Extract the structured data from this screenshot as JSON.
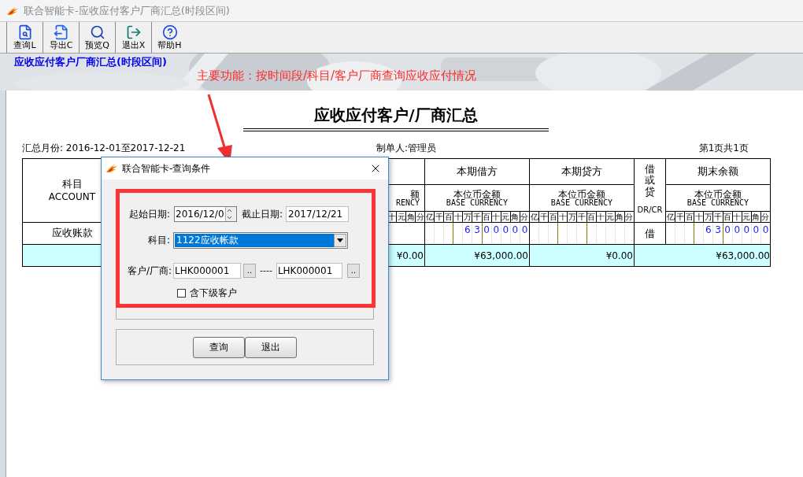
{
  "window": {
    "title": "联合智能卡-应收应付客户厂商汇总(时段区间)"
  },
  "toolbar": [
    {
      "label": "查询L",
      "kind": "query"
    },
    {
      "label": "导出C",
      "kind": "export"
    },
    {
      "label": "预览Q",
      "kind": "preview"
    },
    {
      "label": "退出X",
      "kind": "exit"
    },
    {
      "label": "帮助H",
      "kind": "help"
    }
  ],
  "banner": {
    "title": "应收应付客户厂商汇总(时段区间)",
    "note": "主要功能：按时间段/科目/客户厂商查询应收应付情况"
  },
  "report": {
    "title": "应收应付客户/厂商汇总",
    "period": "汇总月份: 2016-12-01至2017-12-21",
    "maker": "制单人:管理员",
    "page": "第1页共1页",
    "account": {
      "heading": "科目",
      "subheading": "ACCOUNT",
      "cell": "应收账款"
    },
    "partial": {
      "heading": "额",
      "subheading": "RENCY",
      "digit_labels": [
        "十",
        "元",
        "角",
        "分"
      ],
      "total": "¥0.00"
    },
    "columns": [
      {
        "kind": "amount",
        "heading": "本期借方",
        "subheading": "本位币金额",
        "subheading_en": "BASE CURRENCY",
        "digit_labels": [
          "亿",
          "千",
          "百",
          "十",
          "万",
          "千",
          "百",
          "十",
          "元",
          "角",
          "分"
        ],
        "digits": [
          "6",
          "3",
          "0",
          "0",
          "0",
          "0",
          "0"
        ],
        "total": "¥63,000.00"
      },
      {
        "kind": "amount",
        "heading": "本期贷方",
        "subheading": "本位币金额",
        "subheading_en": "BASE CURRENCY",
        "digit_labels": [
          "亿",
          "千",
          "百",
          "十",
          "万",
          "千",
          "百",
          "十",
          "元",
          "角",
          "分"
        ],
        "total": "¥0.00"
      },
      {
        "kind": "drcr",
        "heading": "借或贷",
        "subheading": "DR/CR",
        "cell": "借"
      },
      {
        "kind": "amount",
        "heading": "期末余额",
        "subheading": "本位币金额",
        "subheading_en": "BASE CURRENCY",
        "digit_labels": [
          "亿",
          "千",
          "百",
          "十",
          "万",
          "千",
          "百",
          "十",
          "元",
          "角",
          "分"
        ],
        "digits": [
          "6",
          "3",
          "0",
          "0",
          "0",
          "0",
          "0"
        ],
        "total": "¥63,000.00"
      }
    ]
  },
  "dialog": {
    "title": "联合智能卡-查询条件",
    "start_label": "起始日期:",
    "start_value": "2016/12/0",
    "end_label": "截止日期:",
    "end_value": "2017/12/21",
    "account_label": "科目:",
    "account_value": "1122应收帐款",
    "party_label": "客户/厂商:",
    "party_from": "LHK000001",
    "browse_from": "..",
    "dash": "----",
    "party_to": "LHK000001",
    "browse_to": "..",
    "checkbox": {
      "label": "含下级客户",
      "checked": false
    },
    "buttons": [
      "查询",
      "退出"
    ]
  }
}
